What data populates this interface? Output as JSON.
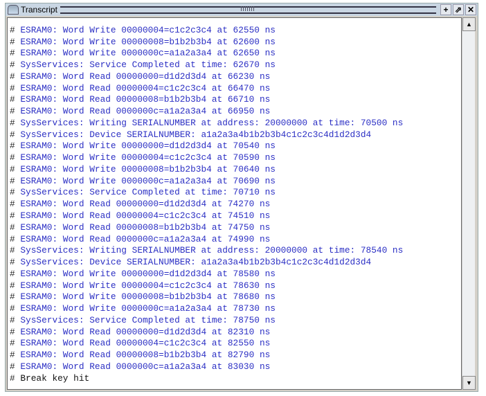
{
  "window": {
    "title": "Transcript",
    "buttons": {
      "add": "+",
      "undock": "⇗",
      "close": "✕"
    }
  },
  "lines": [
    {
      "text": "ESRAM0: Word Write 00000004=c1c2c3c4 at 62550 ns"
    },
    {
      "text": "ESRAM0: Word Write 00000008=b1b2b3b4 at 62600 ns"
    },
    {
      "text": "ESRAM0: Word Write 0000000c=a1a2a3a4 at 62650 ns"
    },
    {
      "text": "SysServices: Service Completed at time: 62670 ns"
    },
    {
      "text": "ESRAM0: Word Read 00000000=d1d2d3d4 at 66230 ns"
    },
    {
      "text": "ESRAM0: Word Read 00000004=c1c2c3c4 at 66470 ns"
    },
    {
      "text": "ESRAM0: Word Read 00000008=b1b2b3b4 at 66710 ns"
    },
    {
      "text": "ESRAM0: Word Read 0000000c=a1a2a3a4 at 66950 ns"
    },
    {
      "text": "SysServices: Writing SERIALNUMBER at address: 20000000 at time: 70500 ns"
    },
    {
      "text": "SysServices: Device SERIALNUMBER: a1a2a3a4b1b2b3b4c1c2c3c4d1d2d3d4"
    },
    {
      "text": "ESRAM0: Word Write 00000000=d1d2d3d4 at 70540 ns"
    },
    {
      "text": "ESRAM0: Word Write 00000004=c1c2c3c4 at 70590 ns"
    },
    {
      "text": "ESRAM0: Word Write 00000008=b1b2b3b4 at 70640 ns"
    },
    {
      "text": "ESRAM0: Word Write 0000000c=a1a2a3a4 at 70690 ns"
    },
    {
      "text": "SysServices: Service Completed at time: 70710 ns"
    },
    {
      "text": "ESRAM0: Word Read 00000000=d1d2d3d4 at 74270 ns"
    },
    {
      "text": "ESRAM0: Word Read 00000004=c1c2c3c4 at 74510 ns"
    },
    {
      "text": "ESRAM0: Word Read 00000008=b1b2b3b4 at 74750 ns"
    },
    {
      "text": "ESRAM0: Word Read 0000000c=a1a2a3a4 at 74990 ns"
    },
    {
      "text": "SysServices: Writing SERIALNUMBER at address: 20000000 at time: 78540 ns"
    },
    {
      "text": "SysServices: Device SERIALNUMBER: a1a2a3a4b1b2b3b4c1c2c3c4d1d2d3d4"
    },
    {
      "text": "ESRAM0: Word Write 00000000=d1d2d3d4 at 78580 ns"
    },
    {
      "text": "ESRAM0: Word Write 00000004=c1c2c3c4 at 78630 ns"
    },
    {
      "text": "ESRAM0: Word Write 00000008=b1b2b3b4 at 78680 ns"
    },
    {
      "text": "ESRAM0: Word Write 0000000c=a1a2a3a4 at 78730 ns"
    },
    {
      "text": "SysServices: Service Completed at time: 78750 ns"
    },
    {
      "text": "ESRAM0: Word Read 00000000=d1d2d3d4 at 82310 ns"
    },
    {
      "text": "ESRAM0: Word Read 00000004=c1c2c3c4 at 82550 ns"
    },
    {
      "text": "ESRAM0: Word Read 00000008=b1b2b3b4 at 82790 ns"
    },
    {
      "text": "ESRAM0: Word Read 0000000c=a1a2a3a4 at 83030 ns"
    },
    {
      "text": "Break key hit",
      "plain": true
    }
  ],
  "prompt_char": "#",
  "scrollbar": {
    "up": "▲",
    "down": "▼",
    "position": 1.0
  }
}
